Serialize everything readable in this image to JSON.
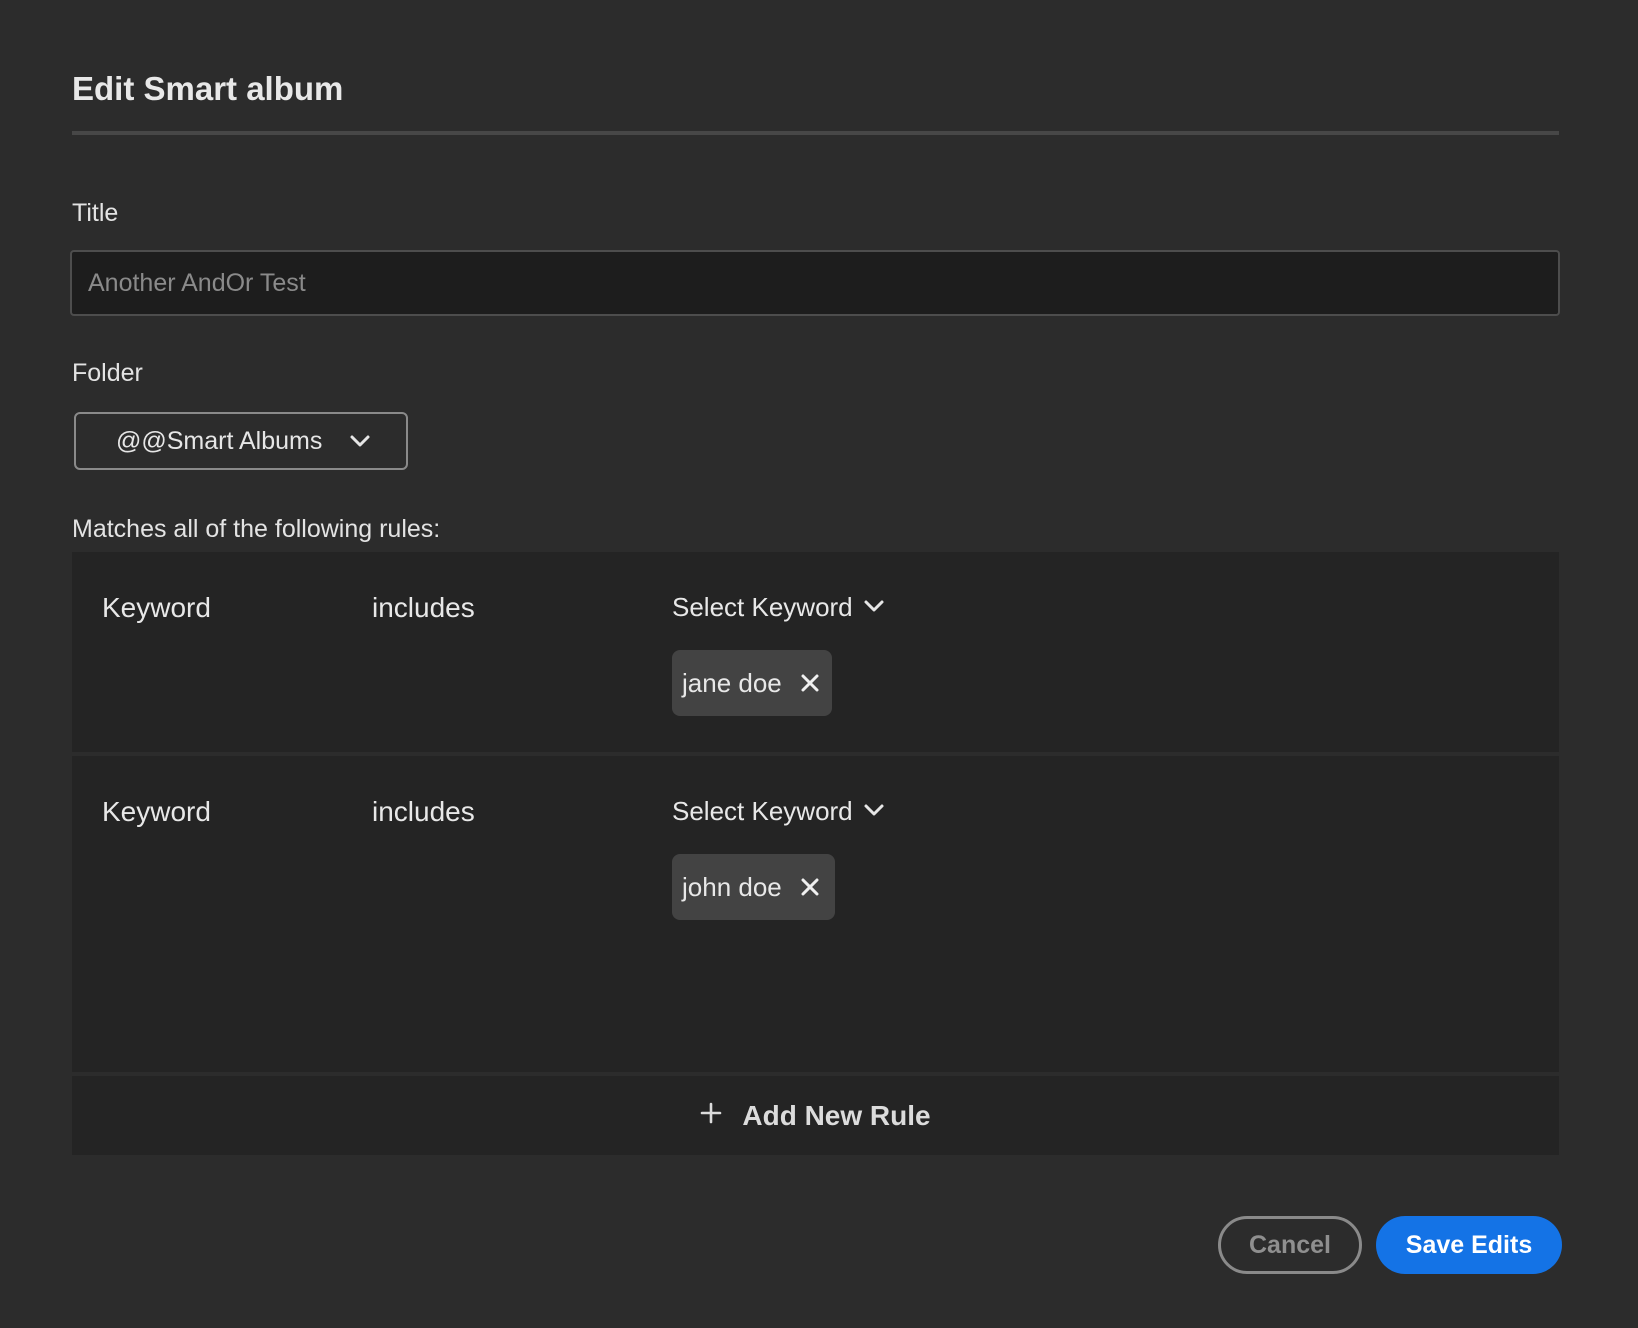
{
  "dialog": {
    "title": "Edit Smart album"
  },
  "title_field": {
    "label": "Title",
    "value": "",
    "placeholder": "Another AndOr Test"
  },
  "folder_field": {
    "label": "Folder",
    "selected": "@@Smart Albums"
  },
  "rules": {
    "caption": "Matches all of the following rules:",
    "items": [
      {
        "field": "Keyword",
        "operator": "includes",
        "selector_label": "Select Keyword",
        "tags": [
          "jane doe"
        ]
      },
      {
        "field": "Keyword",
        "operator": "includes",
        "selector_label": "Select Keyword",
        "tags": [
          "john doe"
        ]
      }
    ],
    "add_label": "Add New Rule"
  },
  "actions": {
    "cancel_label": "Cancel",
    "save_label": "Save Edits"
  },
  "icons": {
    "folder_dropdown": "chevron-down-icon",
    "keyword_dropdown": "chevron-down-icon",
    "tag_remove": "close-icon",
    "add_rule": "plus-icon"
  },
  "colors": {
    "background": "#2c2c2c",
    "rules_background": "#242424",
    "tag_background": "#434343",
    "primary_button": "#1473e6",
    "text": "#e6e6e6"
  }
}
